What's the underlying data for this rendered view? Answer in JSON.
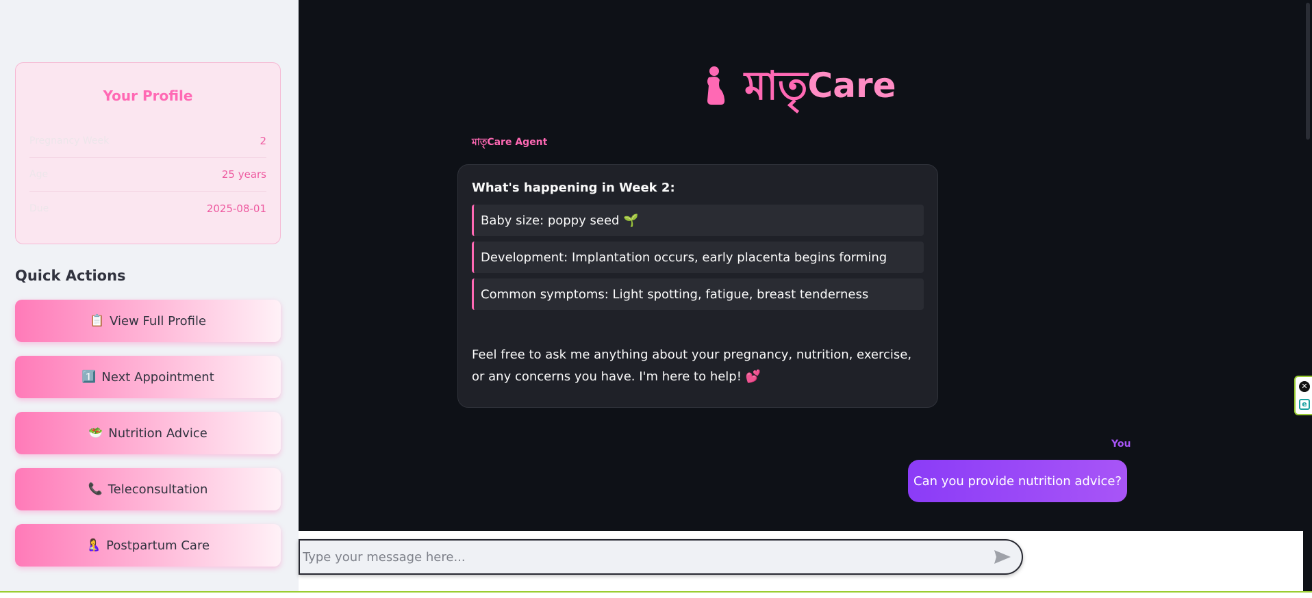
{
  "sidebar": {
    "profile": {
      "title": "Your Profile",
      "rows": [
        {
          "label": "Pregnancy Week",
          "value": "2"
        },
        {
          "label": "Age",
          "value": "25 years"
        },
        {
          "label": "Due",
          "value": "2025-08-01"
        }
      ]
    },
    "quick_actions": {
      "title": "Quick Actions",
      "items": [
        {
          "icon": "📋",
          "label": "View Full Profile"
        },
        {
          "icon": "1️⃣",
          "label": "Next Appointment"
        },
        {
          "icon": "🥗",
          "label": "Nutrition Advice"
        },
        {
          "icon": "📞",
          "label": "Teleconsultation"
        },
        {
          "icon": "🤱",
          "label": "Postpartum Care"
        }
      ]
    }
  },
  "header": {
    "title_bn": "মাতৃ",
    "title_en": "Care"
  },
  "chat": {
    "agent_label": "মাতৃCare Agent",
    "agent_message": {
      "week_title": "What's happening in Week 2:",
      "items": [
        "Baby size: poppy seed 🌱",
        "Development: Implantation occurs, early placenta begins forming",
        "Common symptoms: Light spotting, fatigue, breast tenderness"
      ],
      "closing": "Feel free to ask me anything about your pregnancy, nutrition, exercise, or any concerns you have. I'm here to help! 💕"
    },
    "user_label": "You",
    "user_message": "Can you provide nutrition advice?"
  },
  "input": {
    "placeholder": "Type your message here..."
  },
  "colors": {
    "accent_pink": "#ff69b4",
    "accent_purple": "#a855f7",
    "sidebar_bg": "#f0f2f6",
    "main_bg": "#0e1117"
  }
}
